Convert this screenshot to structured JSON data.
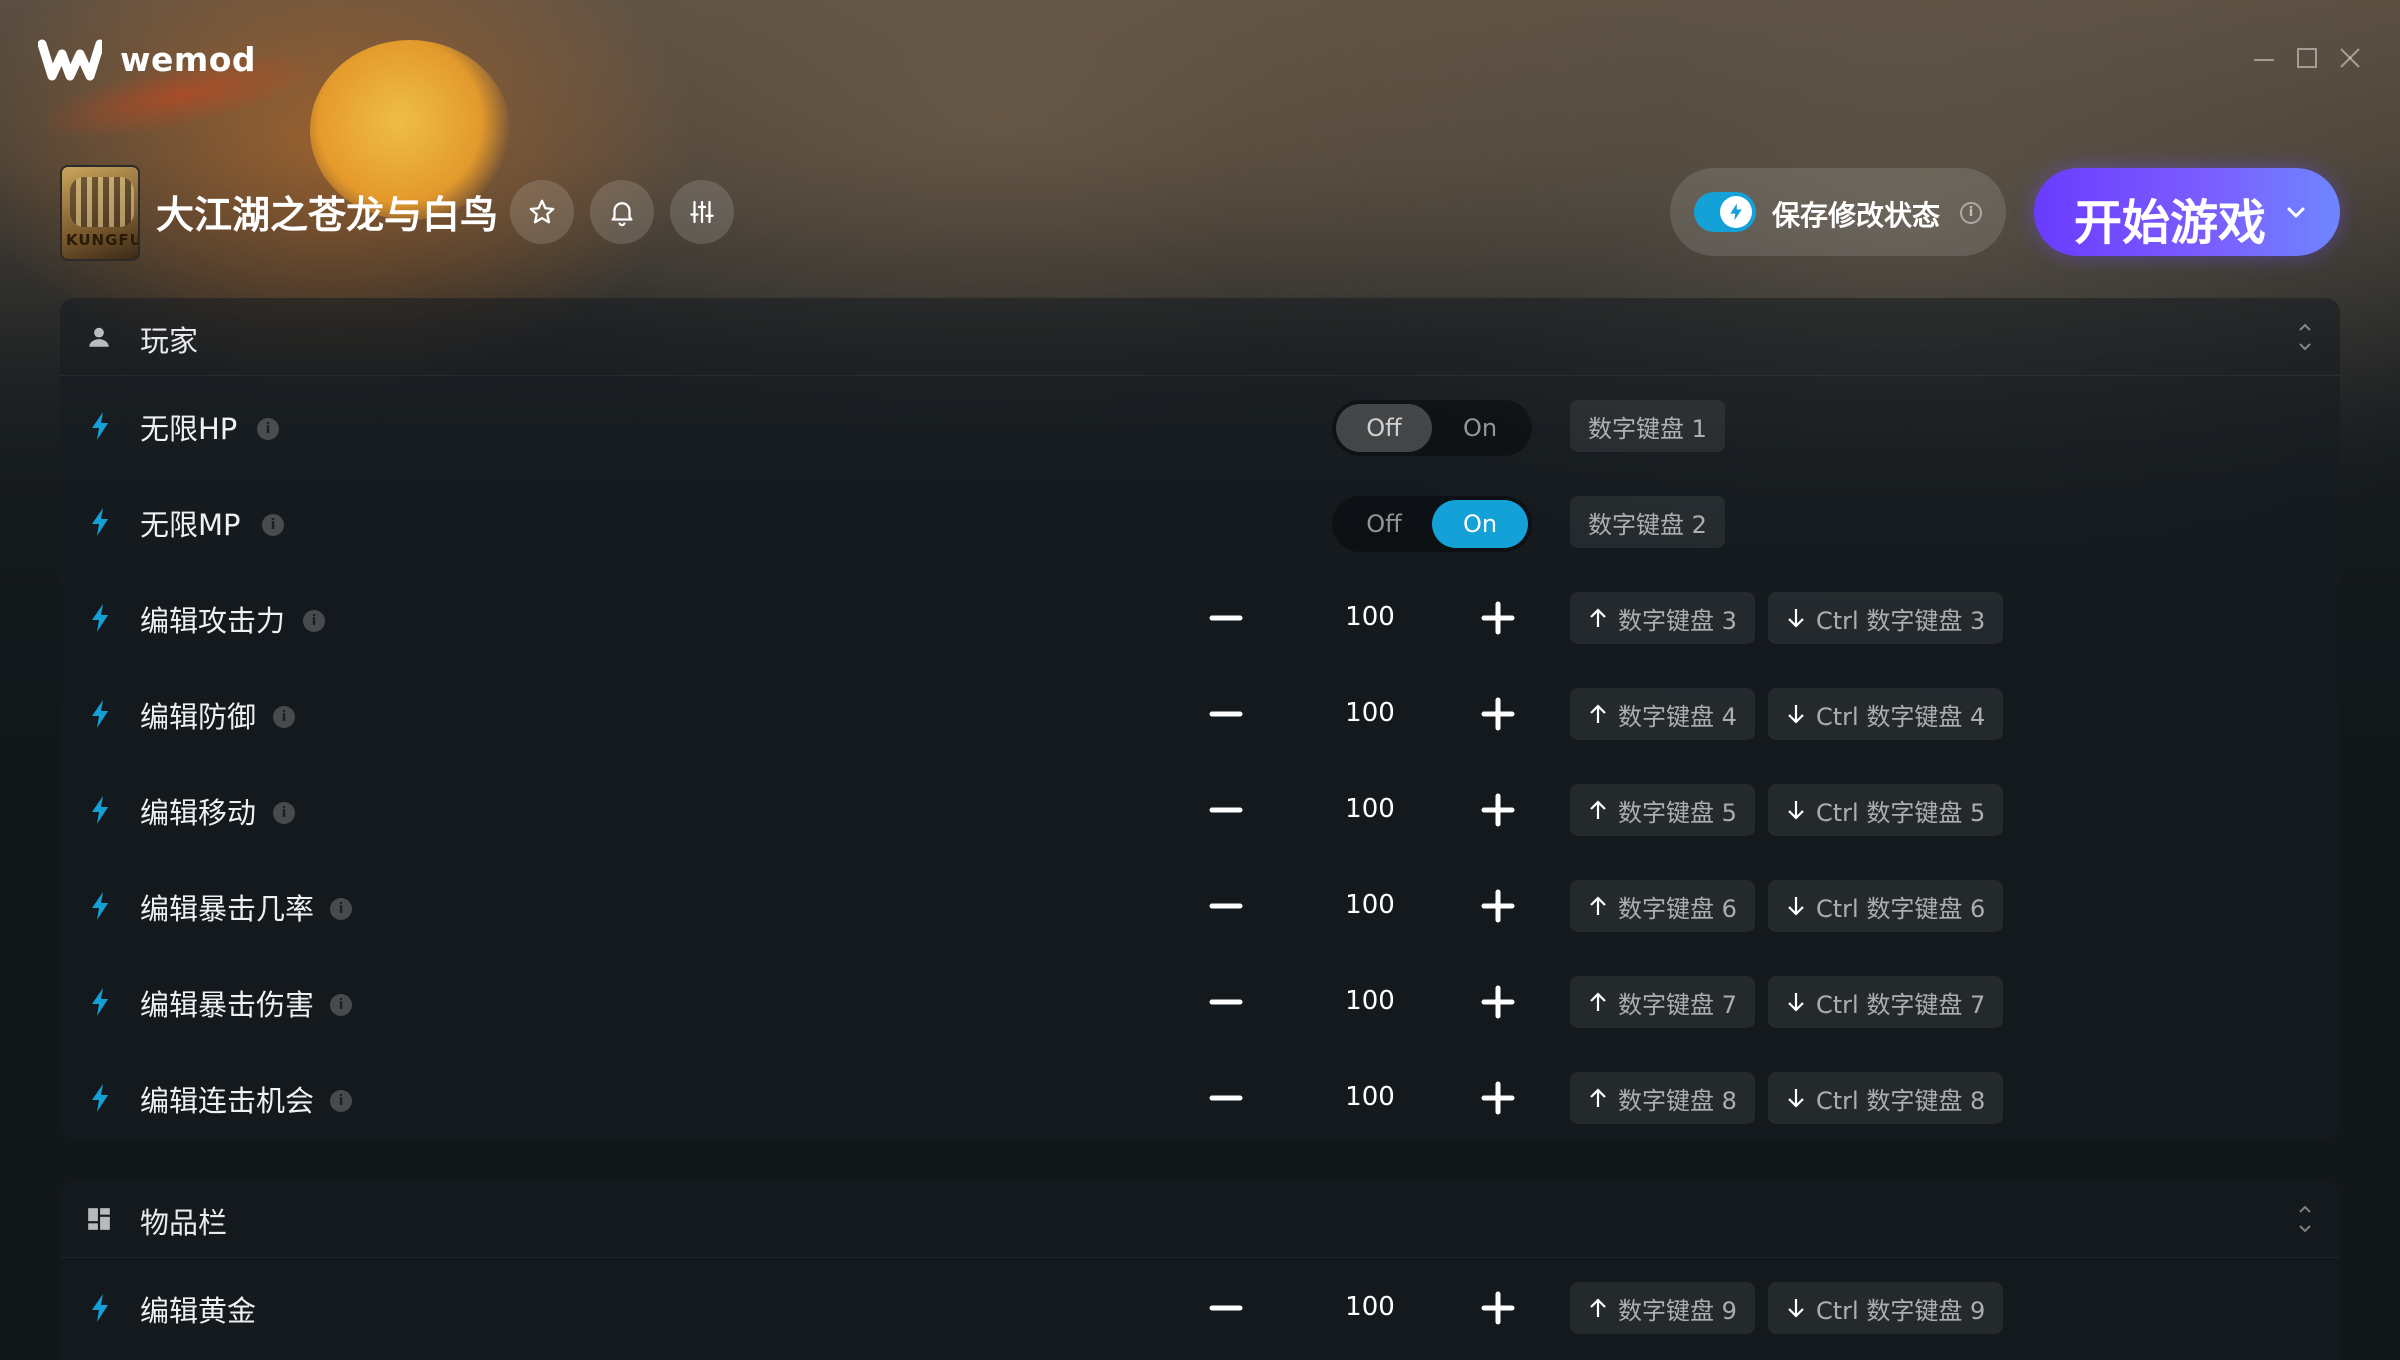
{
  "app": {
    "brand": "wemod"
  },
  "game": {
    "title": "大江湖之苍龙与白鸟",
    "thumb_text": "KUNGFU"
  },
  "save_mods": {
    "label": "保存修改状态",
    "info": "i",
    "enabled": true
  },
  "play": {
    "label": "开始游戏"
  },
  "colors": {
    "accent": "#13a1d8",
    "play_from": "#6a3cff",
    "play_to": "#6f86ff"
  },
  "sections": [
    {
      "label": "玩家",
      "icon": "person-icon",
      "rows": [
        {
          "name": "无限HP",
          "type": "toggle",
          "state": "Off",
          "off_label": "Off",
          "on_label": "On",
          "key": "数字键盘 1"
        },
        {
          "name": "无限MP",
          "type": "toggle",
          "state": "On",
          "off_label": "Off",
          "on_label": "On",
          "key": "数字键盘 2"
        },
        {
          "name": "编辑攻击力",
          "type": "number",
          "value": "100",
          "inc_key": "数字键盘 3",
          "dec_key": "Ctrl 数字键盘 3"
        },
        {
          "name": "编辑防御",
          "type": "number",
          "value": "100",
          "inc_key": "数字键盘 4",
          "dec_key": "Ctrl 数字键盘 4"
        },
        {
          "name": "编辑移动",
          "type": "number",
          "value": "100",
          "inc_key": "数字键盘 5",
          "dec_key": "Ctrl 数字键盘 5"
        },
        {
          "name": "编辑暴击几率",
          "type": "number",
          "value": "100",
          "inc_key": "数字键盘 6",
          "dec_key": "Ctrl 数字键盘 6"
        },
        {
          "name": "编辑暴击伤害",
          "type": "number",
          "value": "100",
          "inc_key": "数字键盘 7",
          "dec_key": "Ctrl 数字键盘 7"
        },
        {
          "name": "编辑连击机会",
          "type": "number",
          "value": "100",
          "inc_key": "数字键盘 8",
          "dec_key": "Ctrl 数字键盘 8"
        }
      ]
    },
    {
      "label": "物品栏",
      "icon": "inventory-icon",
      "rows": [
        {
          "name": "编辑黄金",
          "type": "number",
          "value": "100",
          "inc_key": "数字键盘 9",
          "dec_key": "Ctrl 数字键盘 9"
        }
      ]
    }
  ]
}
